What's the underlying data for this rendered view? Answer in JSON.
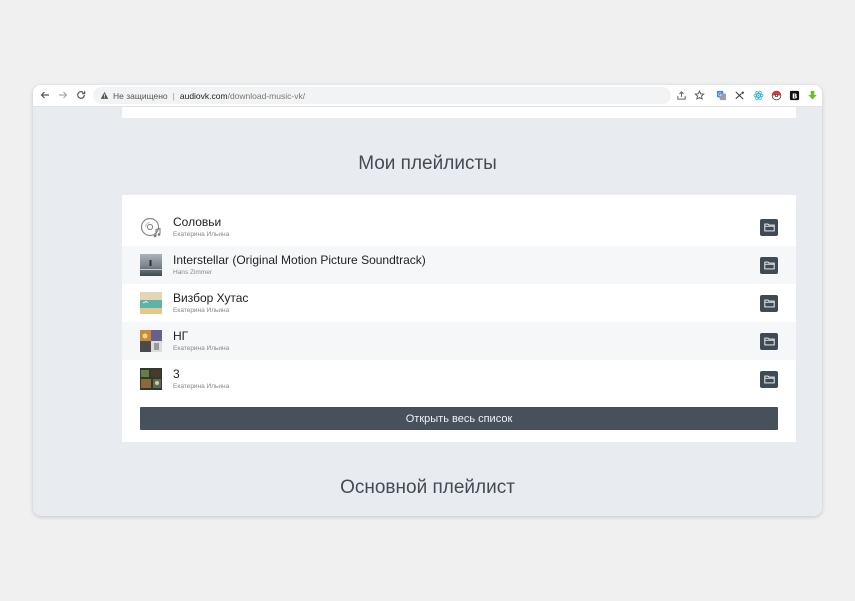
{
  "browser": {
    "security_label": "Не защищено",
    "url_host": "audiovk.com",
    "url_path": "/download-music-vk/"
  },
  "icons": {
    "back": "arrow-left-icon",
    "forward": "arrow-right-icon",
    "reload": "reload-icon",
    "warning": "warning-triangle-icon",
    "share": "share-icon",
    "bookmark": "star-icon",
    "extensions": [
      "translate-icon",
      "scissors-icon",
      "react-icon",
      "pokeball-icon",
      "b-icon",
      "download-arrow-icon"
    ],
    "folder": "folder-icon"
  },
  "my_playlists": {
    "title": "Мои плейлисты",
    "items": [
      {
        "title": "Соловьи",
        "subtitle": "Екатерина Ильина",
        "cover": "disc-music-icon"
      },
      {
        "title": "Interstellar (Original Motion Picture Soundtrack)",
        "subtitle": "Hans Zimmer",
        "cover": "cover-image"
      },
      {
        "title": "Визбор Хутас",
        "subtitle": "Екатерина Ильина",
        "cover": "cover-image"
      },
      {
        "title": "НГ",
        "subtitle": "Екатерина Ильина",
        "cover": "cover-image"
      },
      {
        "title": "3",
        "subtitle": "Екатерина Ильина",
        "cover": "cover-image"
      }
    ],
    "open_all_label": "Открыть весь список"
  },
  "main_playlist": {
    "title": "Основной плейлист"
  },
  "colors": {
    "page_bg": "#e8ecf1",
    "button_dark": "#46515b",
    "folder_button": "#3f4a54"
  }
}
